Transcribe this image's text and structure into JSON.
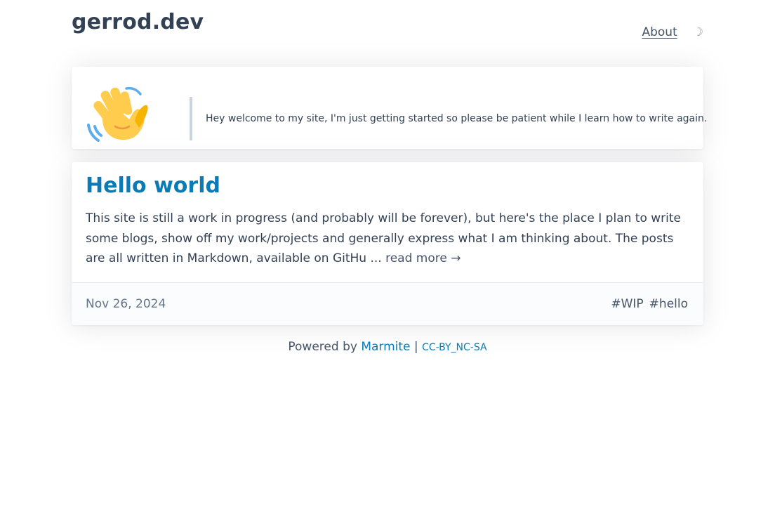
{
  "header": {
    "site_title": "gerrod.dev",
    "nav": [
      {
        "label": "About"
      }
    ],
    "theme_toggle_icon": "moon-icon",
    "theme_toggle_glyph": "☽"
  },
  "intro": {
    "icon": "waving-hand-icon",
    "text": "Hey welcome to my site, I'm just getting started so please be patient while I learn how to write again."
  },
  "post": {
    "title": "Hello world",
    "excerpt": "This site is still a work in progress (and probably will be forever), but here's the place I plan to write some blogs, show off my work/projects and generally express what I am thinking about. The posts are all written in Markdown, available on GitHu ...",
    "read_more": "read more →",
    "date": "Nov 26, 2024",
    "tags": [
      "#WIP",
      "#hello"
    ]
  },
  "footer": {
    "powered_by": "Powered by",
    "generator": "Marmite",
    "separator": "|",
    "license": "CC-BY_NC-SA"
  },
  "colors": {
    "accent": "#0b7bb5",
    "text": "#334155",
    "muted": "#64748b",
    "wave_yellow": "#FFCC4D",
    "wave_lines": "#5DADEC"
  }
}
